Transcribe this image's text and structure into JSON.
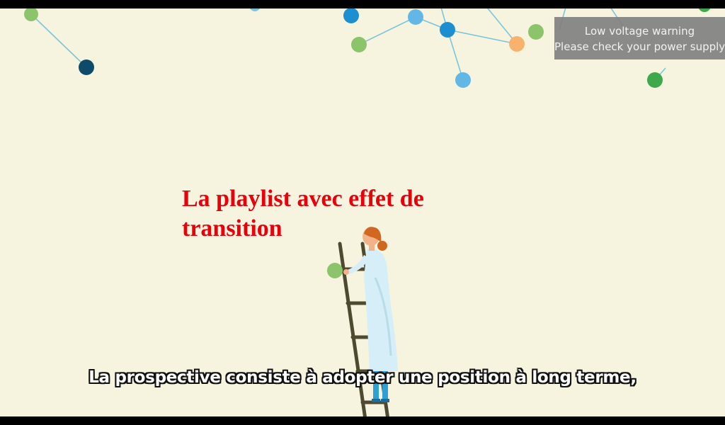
{
  "video": {
    "overlay_title": "La playlist avec effet de transition",
    "subtitle": "La prospective consiste à adopter une position à long terme,"
  },
  "notification": {
    "line1": "Low voltage warning",
    "line2": "Please check your power supply"
  },
  "colors": {
    "background": "#f6f4df",
    "title": "#e8000b",
    "toast_bg": "#808080"
  }
}
